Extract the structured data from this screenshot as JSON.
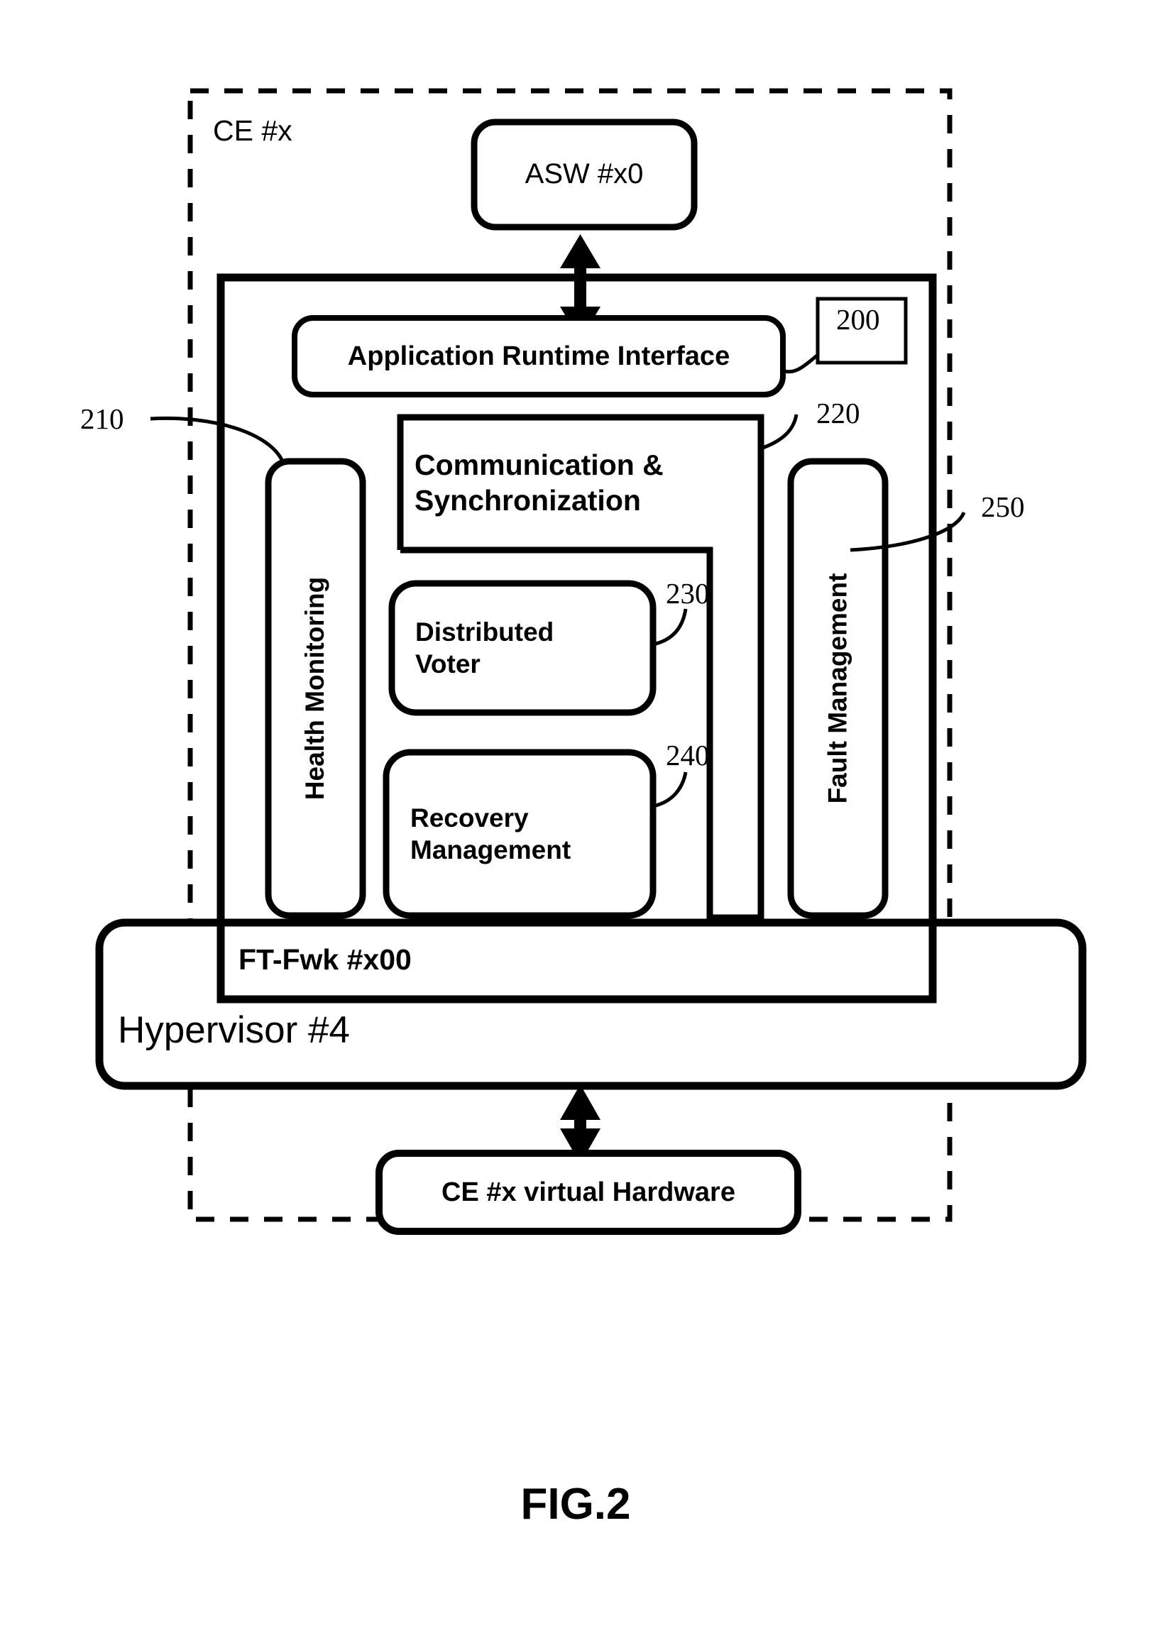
{
  "figure": {
    "caption": "FIG.2",
    "outer_container_label": "CE #x",
    "blocks": {
      "asw": {
        "label": "ASW #x0"
      },
      "application_runtime_interface": {
        "label": "Application Runtime Interface"
      },
      "health_monitoring": {
        "label": "Health Monitoring"
      },
      "communication_synchronization": {
        "line1": "Communication &",
        "line2": "Synchronization"
      },
      "distributed_voter": {
        "line1": "Distributed",
        "line2": "Voter"
      },
      "recovery_management": {
        "line1": "Recovery",
        "line2": "Management"
      },
      "fault_management": {
        "label": "Fault Management"
      },
      "ft_framework": {
        "label": "FT-Fwk #x00"
      },
      "hypervisor": {
        "label": "Hypervisor #4"
      },
      "virtual_hardware": {
        "label": "CE #x virtual Hardware"
      }
    },
    "reference_numerals": {
      "art": "200",
      "health_monitoring": "210",
      "comm_sync": "220",
      "distributed_voter": "230",
      "recovery_management": "240",
      "fault_management": "250"
    },
    "colors": {
      "stroke": "#000000",
      "background": "#ffffff"
    }
  }
}
